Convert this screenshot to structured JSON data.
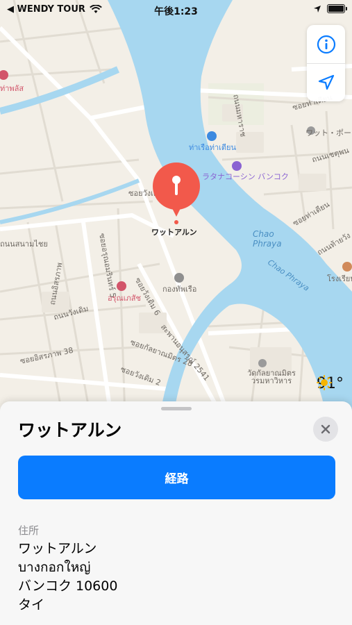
{
  "status_bar": {
    "carrier": "◀ WENDY TOUR",
    "time": "午後1:23"
  },
  "map": {
    "labels": {
      "pier": "ท่าเรือท่าเตียน",
      "hotel": "ラタナコーシン バンコク",
      "chao_phraya_1": "Chao\nPhraya",
      "chao_phraya_2": "Chao Phraya",
      "wat_pho": "ワット・ポー",
      "navy": "กองทัพเรือ",
      "hospital": "อรุณเภสัช",
      "temple": "วัดกัลยาณมิตร วรมหาวิหาร",
      "pin": "ワットアルン",
      "road_1": "ถนนมหาราช",
      "road_2": "ซอยวังเดิม",
      "road_3": "ซอยอิสรภาพ 38",
      "road_4": "ซอยกัลยาณมิตร 28",
      "road_5": "ซอยวังเดิม 2",
      "road_6": "ซอยอรุณอมรินทร์ 5",
      "road_7": "ถนนอิสรภาพ",
      "road_8": "ถนนวังเดิม",
      "road_9": "สะพานอนุสรณ์ 2541",
      "road_10": "ท่าพลัส",
      "road_11": "ซอยท่าเตียน",
      "road_12": "ถนนเชตุพน",
      "road_13": "ซอยท่าเตียน",
      "road_14": "ถนนท้ายวัง",
      "road_15": "โรงเรียน",
      "road_16": "ซอยวังเดิม 6",
      "road_17": "ถนนสนามไชย"
    },
    "weather": {
      "temperature": "91°",
      "icon": "sun-icon"
    },
    "controls": {
      "info_icon": "info-icon",
      "location_icon": "location-arrow-icon"
    }
  },
  "sheet": {
    "title": "ワットアルン",
    "route_button": "経路",
    "address_heading": "住所",
    "address_lines": [
      "ワットアルン",
      "บางกอกใหญ่",
      "バンコク 10600",
      "タイ"
    ]
  },
  "colors": {
    "accent": "#0a7cff",
    "pin": "#f2594b",
    "water": "#a7d7f0",
    "land": "#f3efe7"
  }
}
